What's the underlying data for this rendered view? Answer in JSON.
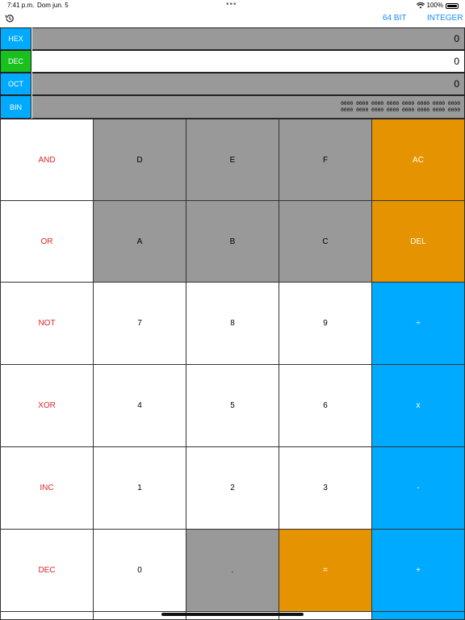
{
  "status_bar": {
    "time": "7:41 p.m.",
    "date": "Dom jun. 5",
    "dots": "•••",
    "battery": "100%"
  },
  "toolbar": {
    "history_icon": "history-icon",
    "bits_label": "64 BIT",
    "mode_label": "INTEGER",
    "accent_color": "#1a8cff"
  },
  "display": {
    "hex": {
      "label": "HEX",
      "value": "0",
      "color": "#00aaff"
    },
    "dec": {
      "label": "DEC",
      "value": "0",
      "color": "#19c11f"
    },
    "oct": {
      "label": "OCT",
      "value": "0",
      "color": "#00aaff"
    },
    "bin": {
      "label": "BIN",
      "line1": "0000 0000 0000 0000 0000 0000 0000 0000",
      "line2": "0000 0000 0000 0000 0000 0000 0000 0000",
      "color": "#00aaff"
    }
  },
  "keypad": {
    "rows": [
      [
        "AND",
        "D",
        "E",
        "F",
        "AC"
      ],
      [
        "OR",
        "A",
        "B",
        "C",
        "DEL"
      ],
      [
        "NOT",
        "7",
        "8",
        "9",
        "÷"
      ],
      [
        "XOR",
        "4",
        "5",
        "6",
        "x"
      ],
      [
        "INC",
        "1",
        "2",
        "3",
        "-"
      ],
      [
        "DEC",
        "0",
        ".",
        "=",
        "+"
      ]
    ],
    "colors": {
      "gray": "#999999",
      "orange": "#e59400",
      "blue": "#00aaff",
      "red_text": "#e0242a"
    }
  }
}
